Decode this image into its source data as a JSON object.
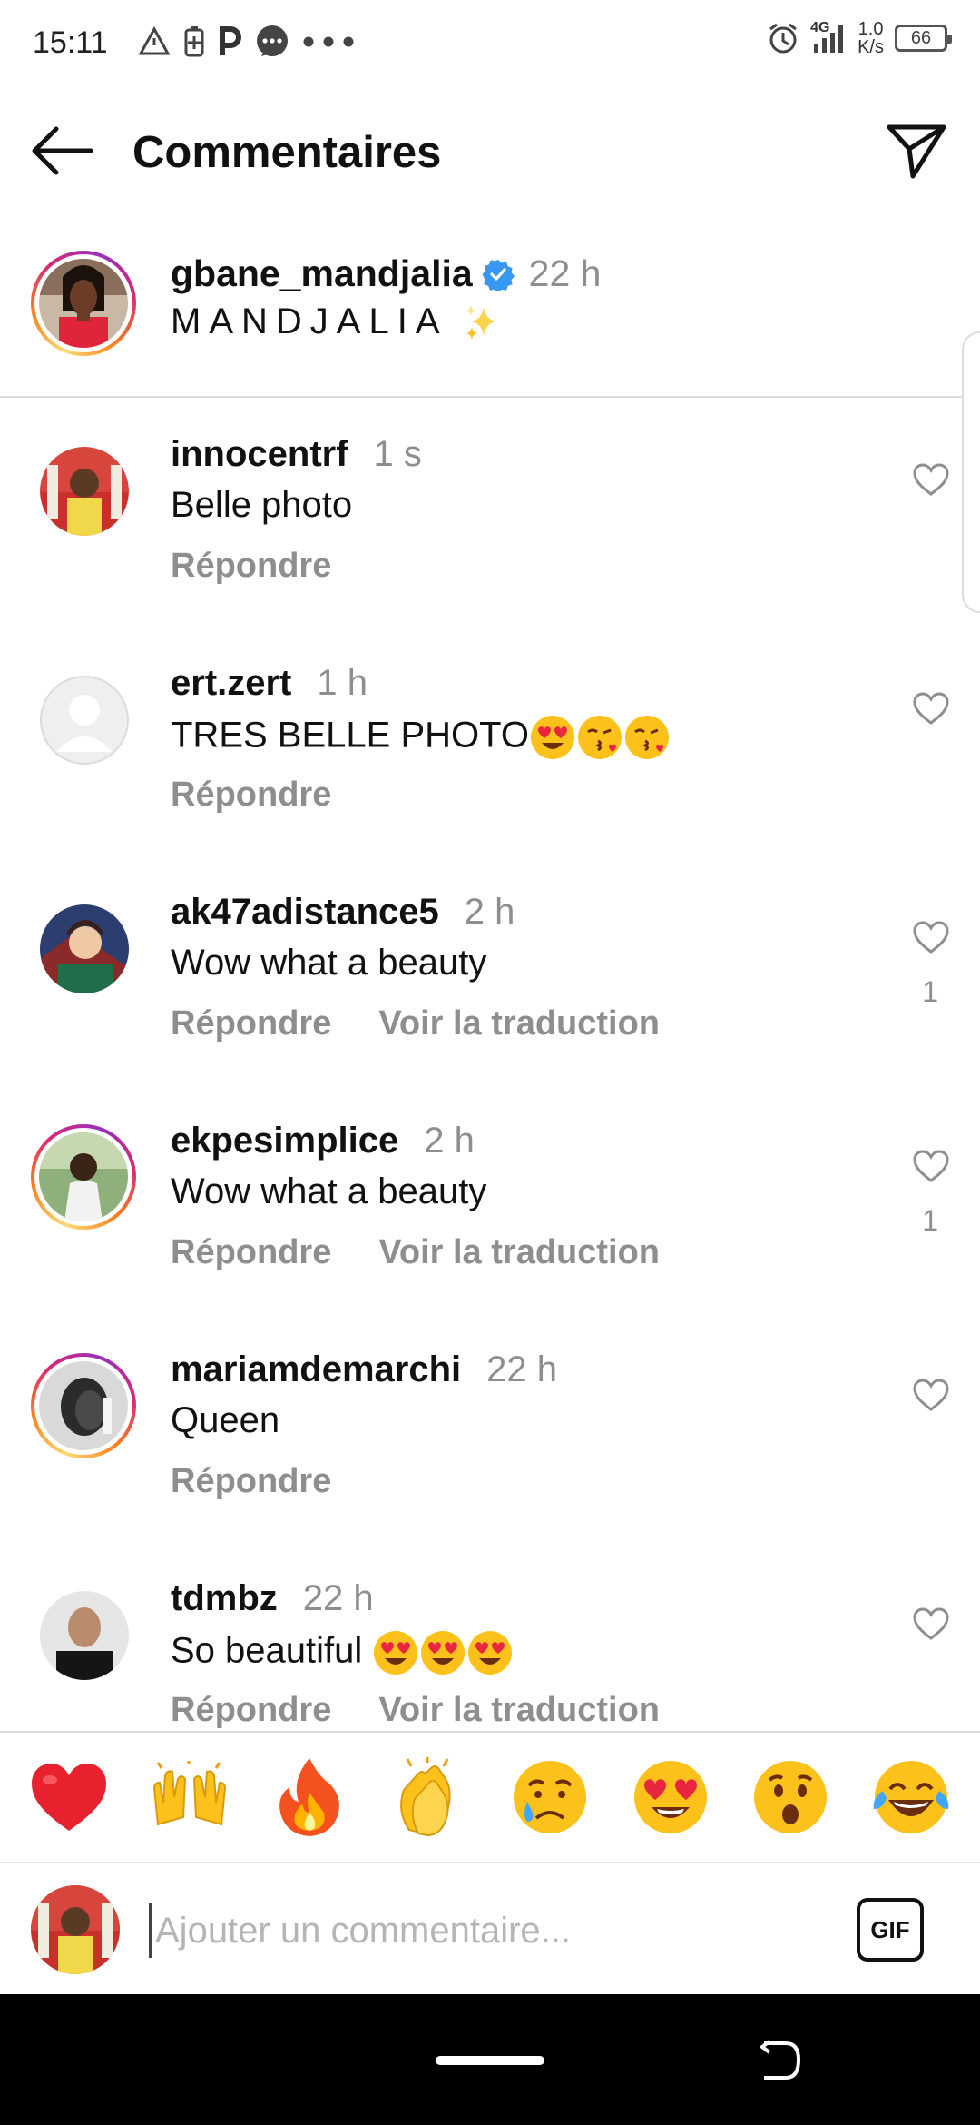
{
  "status_bar": {
    "time": "15:11",
    "network": "4G",
    "speed_value": "1.0",
    "speed_unit": "K/s",
    "battery": "66"
  },
  "header": {
    "title": "Commentaires"
  },
  "caption": {
    "username": "gbane_mandjalia",
    "time": "22 h",
    "text": "MANDJALIA",
    "text_emoji": "sparkles"
  },
  "comments": [
    {
      "username": "innocentrf",
      "time": "1 s",
      "text": "Belle photo",
      "emojis": [],
      "reply": "Répondre",
      "translate": "",
      "likes": ""
    },
    {
      "username": "ert.zert",
      "time": "1 h",
      "text": "TRES BELLE PHOTO",
      "emojis": [
        "heart-eyes",
        "kiss",
        "kiss"
      ],
      "reply": "Répondre",
      "translate": "",
      "likes": ""
    },
    {
      "username": "ak47adistance5",
      "time": "2 h",
      "text": "Wow what a beauty",
      "emojis": [],
      "reply": "Répondre",
      "translate": "Voir la traduction",
      "likes": "1"
    },
    {
      "username": "ekpesimplice",
      "time": "2 h",
      "text": "Wow what a beauty",
      "emojis": [],
      "reply": "Répondre",
      "translate": "Voir la traduction",
      "likes": "1"
    },
    {
      "username": "mariamdemarchi",
      "time": "22 h",
      "text": "Queen",
      "emojis": [],
      "reply": "Répondre",
      "translate": "",
      "likes": ""
    },
    {
      "username": "tdmbz",
      "time": "22 h",
      "text": "So beautiful ",
      "emojis": [
        "heart-eyes",
        "heart-eyes",
        "heart-eyes"
      ],
      "reply": "Répondre",
      "translate": "Voir la traduction",
      "likes": ""
    }
  ],
  "reactions": [
    "red-heart",
    "raising-hands",
    "fire",
    "clapping-hands",
    "crying-face",
    "heart-eyes",
    "surprised-face",
    "tears-of-joy"
  ],
  "input": {
    "placeholder": "Ajouter un commentaire...",
    "gif_label": "GIF"
  },
  "colors": {
    "verified": "#3897f0",
    "secondary_text": "#8e8e8e",
    "divider": "#dbdbdb"
  }
}
